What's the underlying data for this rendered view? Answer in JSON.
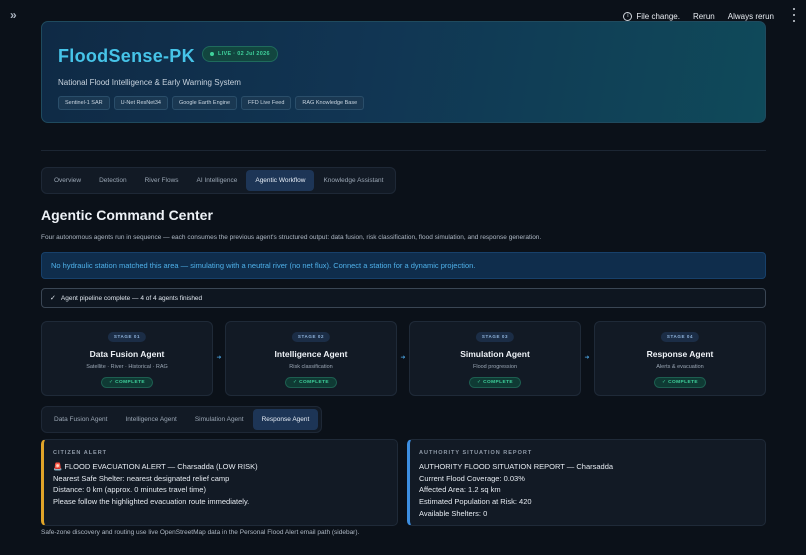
{
  "header": {
    "collapse_icon": "chevrons-right-icon",
    "status_text": "File change.",
    "rerun_label": "Rerun",
    "always_rerun_label": "Always rerun"
  },
  "hero": {
    "title": "FloodSense-PK",
    "live_badge": "LIVE · 02 Jul 2026",
    "subtitle": "National Flood Intelligence & Early Warning System",
    "tags": [
      "Sentinel-1 SAR",
      "U-Net ResNet34",
      "Google Earth Engine",
      "FFD Live Feed",
      "RAG Knowledge Base"
    ]
  },
  "main_tabs": [
    "Overview",
    "Detection",
    "River Flows",
    "AI Intelligence",
    "Agentic Workflow",
    "Knowledge Assistant"
  ],
  "active_main_tab": "Agentic Workflow",
  "page": {
    "title": "Agentic Command Center",
    "description": "Four autonomous agents run in sequence — each consumes the previous agent's structured output: data fusion, risk classification, flood simulation, and response generation.",
    "info_banner": "No hydraulic station matched this area — simulating with a neutral river (no net flux). Connect a station for a dynamic projection.",
    "pipeline_status": "Agent pipeline complete — 4 of 4 agents finished"
  },
  "stages": [
    {
      "badge": "STAGE 01",
      "name": "Data Fusion Agent",
      "desc": "Satellite · River · Historical · RAG",
      "status": "✓ COMPLETE"
    },
    {
      "badge": "STAGE 02",
      "name": "Intelligence Agent",
      "desc": "Risk classification",
      "status": "✓ COMPLETE"
    },
    {
      "badge": "STAGE 03",
      "name": "Simulation Agent",
      "desc": "Flood progression",
      "status": "✓ COMPLETE"
    },
    {
      "badge": "STAGE 04",
      "name": "Response Agent",
      "desc": "Alerts & evacuation",
      "status": "✓ COMPLETE"
    }
  ],
  "agent_tabs": [
    "Data Fusion Agent",
    "Intelligence Agent",
    "Simulation Agent",
    "Response Agent"
  ],
  "active_agent_tab": "Response Agent",
  "citizen_alert": {
    "label": "CITIZEN ALERT",
    "lines": [
      "🚨 FLOOD EVACUATION ALERT — Charsadda (LOW RISK)",
      "Nearest Safe Shelter: nearest designated relief camp",
      "Distance: 0 km (approx. 0 minutes travel time)",
      "Please follow the highlighted evacuation route immediately."
    ]
  },
  "authority_report": {
    "label": "AUTHORITY SITUATION REPORT",
    "lines": [
      "AUTHORITY FLOOD SITUATION REPORT — Charsadda",
      "Current Flood Coverage: 0.03%",
      "Affected Area: 1.2 sq km",
      "Estimated Population at Risk: 420",
      "Available Shelters: 0"
    ]
  },
  "footer_note": "Safe-zone discovery and routing use live OpenStreetMap data in the Personal Flood Alert email path (sidebar).",
  "colors": {
    "accent": "#46c4e8",
    "active_tab": "#1d3556",
    "success": "#3fd29c",
    "citizen_border": "#e0a429",
    "authority_border": "#3d8ee0",
    "info_text": "#4fb1ea"
  }
}
